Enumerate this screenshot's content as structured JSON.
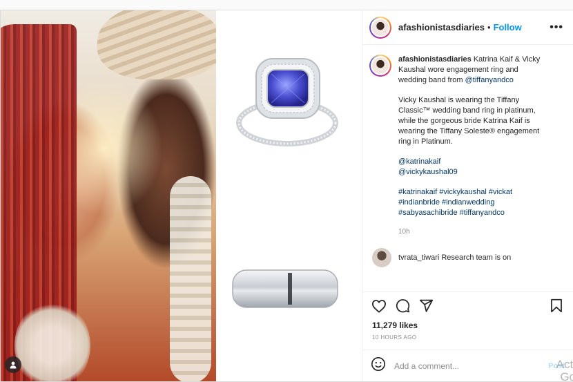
{
  "post": {
    "username": "afashionistasdiaries",
    "separator": "•",
    "follow_label": "Follow",
    "more_label": "•••"
  },
  "caption": {
    "username": "afashionistasdiaries",
    "line1": "Katrina Kaif & Vicky Kaushal wore engagement ring and wedding band from",
    "mention_brand": "@tiffanyandco",
    "para2": "Vicky Kaushal is wearing the Tiffany Classic™ wedding band ring in platinum, while the gorgeous bride Katrina Kaif is wearing the Tiffany Soleste® engagement ring in Platinum.",
    "mention1": "@katrinakaif",
    "mention2": "@vickykaushal09",
    "hashtags": "#katrinakaif #vickykaushal #vickat #indianbride #indianwedding #sabyasachibride #tiffanyandco",
    "time": "10h"
  },
  "reply_preview": {
    "text": "tvrata_tiwari Research team is on"
  },
  "stats": {
    "likes": "11,279 likes",
    "posted_ago": "10 HOURS AGO"
  },
  "comment_box": {
    "placeholder": "Add a comment...",
    "post_label": "Post"
  },
  "watermark": {
    "line1": "Acti",
    "line2": "Go"
  },
  "icons": {
    "heart": "heart-icon",
    "comment": "comment-icon",
    "share": "share-icon",
    "save": "bookmark-icon",
    "emoji": "emoji-icon",
    "person": "person-tag-icon"
  }
}
